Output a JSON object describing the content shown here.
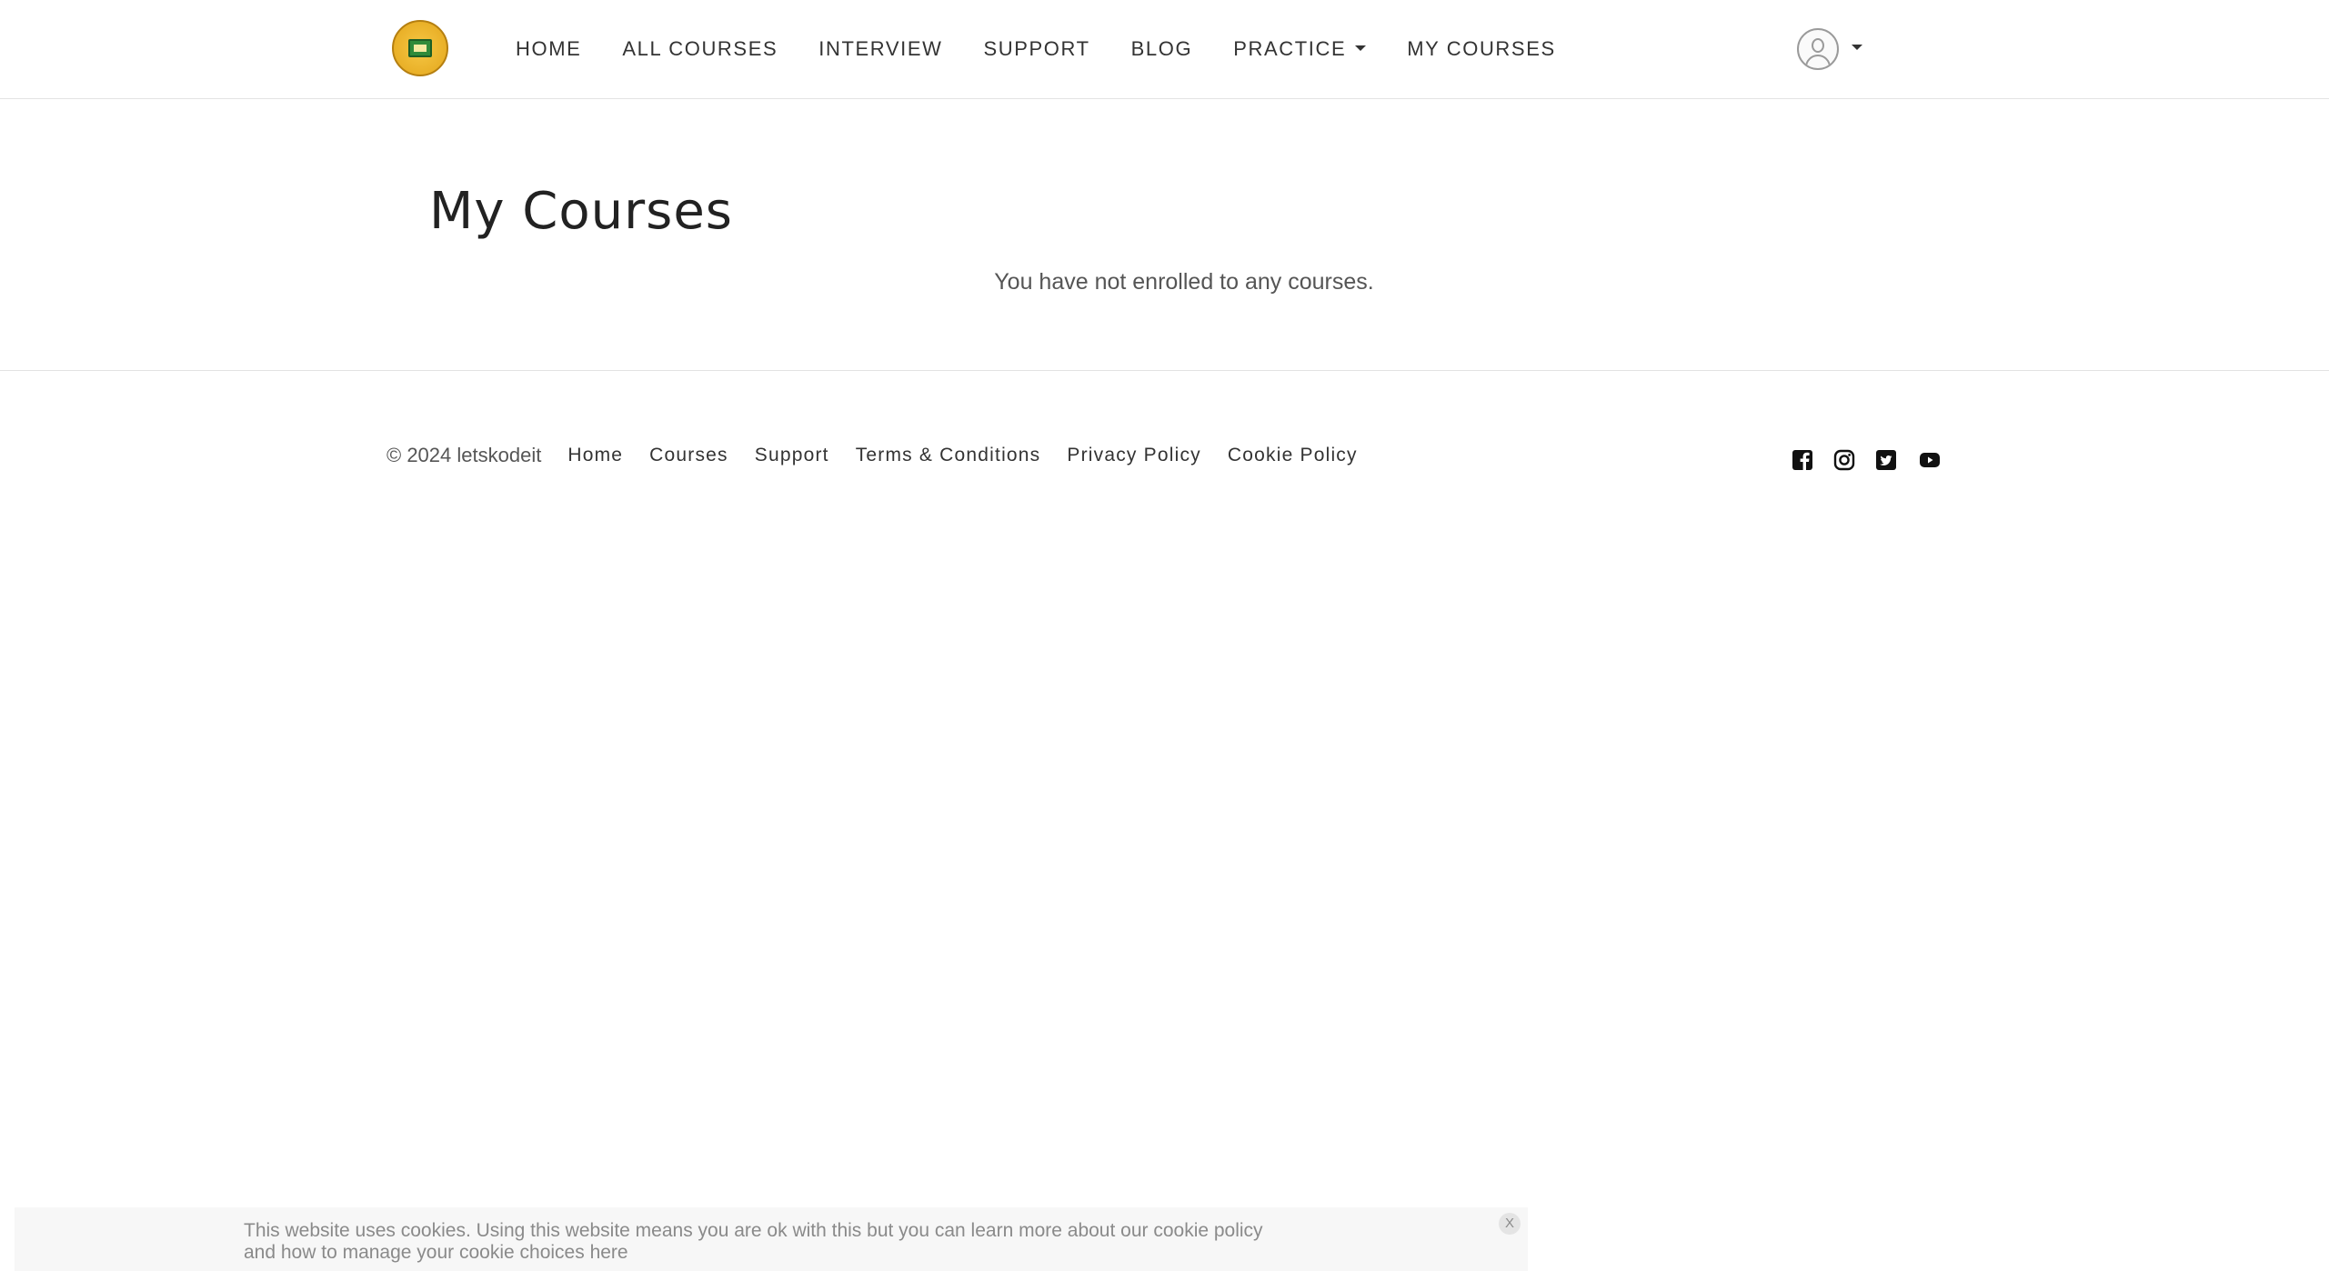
{
  "header": {
    "nav": [
      {
        "label": "HOME"
      },
      {
        "label": "ALL COURSES"
      },
      {
        "label": "INTERVIEW"
      },
      {
        "label": "SUPPORT"
      },
      {
        "label": "BLOG"
      },
      {
        "label": "PRACTICE",
        "has_dropdown": true
      },
      {
        "label": "MY COURSES"
      }
    ],
    "user_menu_icon": "avatar-icon",
    "dropdown_icon": "caret-down-icon"
  },
  "main": {
    "title": "My Courses",
    "empty_message": "You have not enrolled to any courses."
  },
  "footer": {
    "copyright": "© 2024 letskodeit",
    "links": [
      "Home",
      "Courses",
      "Support",
      "Terms & Conditions",
      "Privacy Policy",
      "Cookie Policy"
    ],
    "social": [
      "facebook-icon",
      "instagram-icon",
      "twitter-icon",
      "youtube-icon"
    ]
  },
  "cookie_banner": {
    "text_line1": "This website uses cookies. Using this website means you are ok with this but you can learn more about our cookie policy",
    "text_line2": "and how to manage your cookie choices here",
    "close_label": "X"
  },
  "colors": {
    "text": "#333333",
    "muted": "#8a8a8a",
    "border": "#e3e3e3",
    "logo_gold": "#e9b028",
    "logo_green": "#2f8a3a"
  }
}
